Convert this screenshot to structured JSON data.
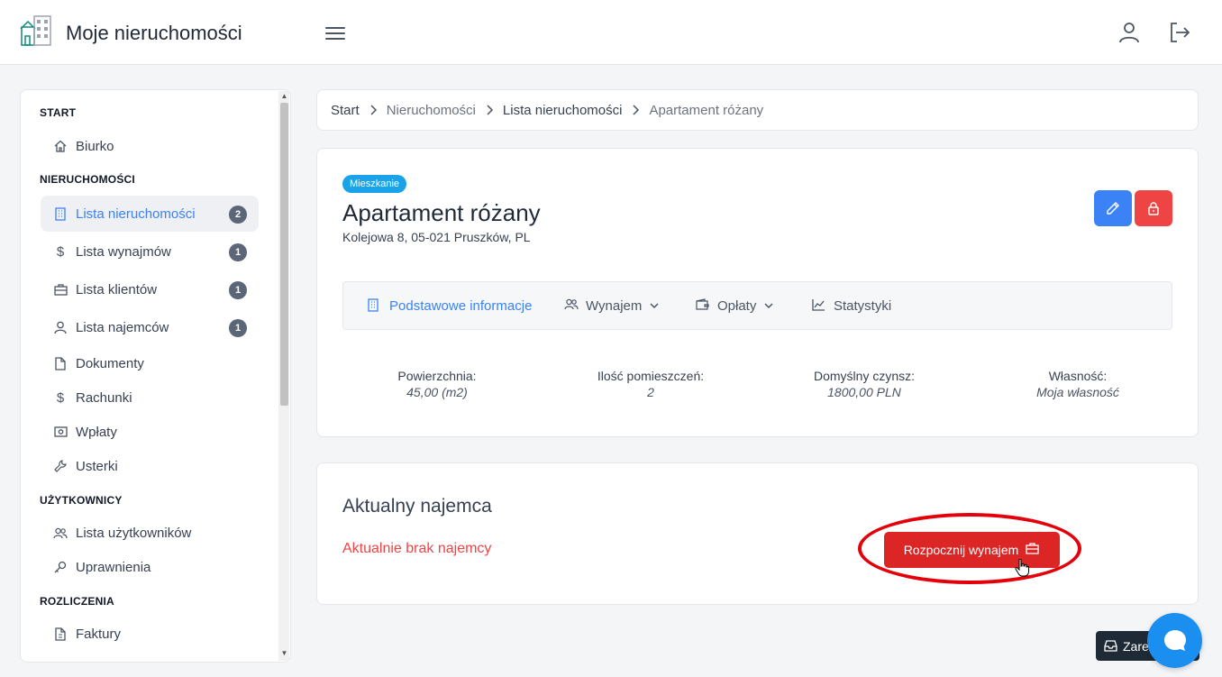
{
  "app": {
    "title": "Moje nieruchomości"
  },
  "sidebar": {
    "sections": [
      {
        "label": "START"
      },
      {
        "label": "NIERUCHOMOŚCI"
      },
      {
        "label": "UŻYTKOWNICY"
      },
      {
        "label": "ROZLICZENIA"
      }
    ],
    "items": [
      {
        "label": "Biurko",
        "icon": "home-icon"
      },
      {
        "label": "Lista nieruchomości",
        "icon": "building-icon",
        "badge": "2",
        "active": true
      },
      {
        "label": "Lista wynajmów",
        "icon": "dollar-icon",
        "badge": "1"
      },
      {
        "label": "Lista klientów",
        "icon": "briefcase-icon",
        "badge": "1"
      },
      {
        "label": "Lista najemców",
        "icon": "user-icon",
        "badge": "1"
      },
      {
        "label": "Dokumenty",
        "icon": "file-icon"
      },
      {
        "label": "Rachunki",
        "icon": "dollar-icon"
      },
      {
        "label": "Wpłaty",
        "icon": "cash-icon"
      },
      {
        "label": "Usterki",
        "icon": "wrench-icon"
      },
      {
        "label": "Lista użytkowników",
        "icon": "users-icon"
      },
      {
        "label": "Uprawnienia",
        "icon": "key-icon"
      },
      {
        "label": "Faktury",
        "icon": "invoice-icon"
      }
    ]
  },
  "breadcrumb": [
    "Start",
    "Nieruchomości",
    "Lista nieruchomości",
    "Apartament różany"
  ],
  "property": {
    "type": "Mieszkanie",
    "name": "Apartament różany",
    "address": "Kolejowa 8, 05-021 Pruszków, PL",
    "tabs": [
      {
        "label": "Podstawowe informacje",
        "active": true
      },
      {
        "label": "Wynajem",
        "dropdown": true
      },
      {
        "label": "Opłaty",
        "dropdown": true
      },
      {
        "label": "Statystyki"
      }
    ],
    "stats": [
      {
        "label": "Powierzchnia:",
        "value": "45,00 (m2)"
      },
      {
        "label": "Ilość pomieszczeń:",
        "value": "2"
      },
      {
        "label": "Domyślny czynsz:",
        "value": "1800,00 PLN"
      },
      {
        "label": "Własność:",
        "value": "Moja własność"
      }
    ]
  },
  "tenant": {
    "title": "Aktualny najemca",
    "empty_text": "Aktualnie brak najemcy",
    "start_button": "Rozpocznij wynajem"
  },
  "footer": {
    "reserve_label": "Zarez"
  },
  "colors": {
    "primary": "#3b82f6",
    "danger": "#dc2626",
    "badge": "#1aa3e8",
    "chat": "#1a8ff0",
    "annotation": "#e3000b"
  }
}
